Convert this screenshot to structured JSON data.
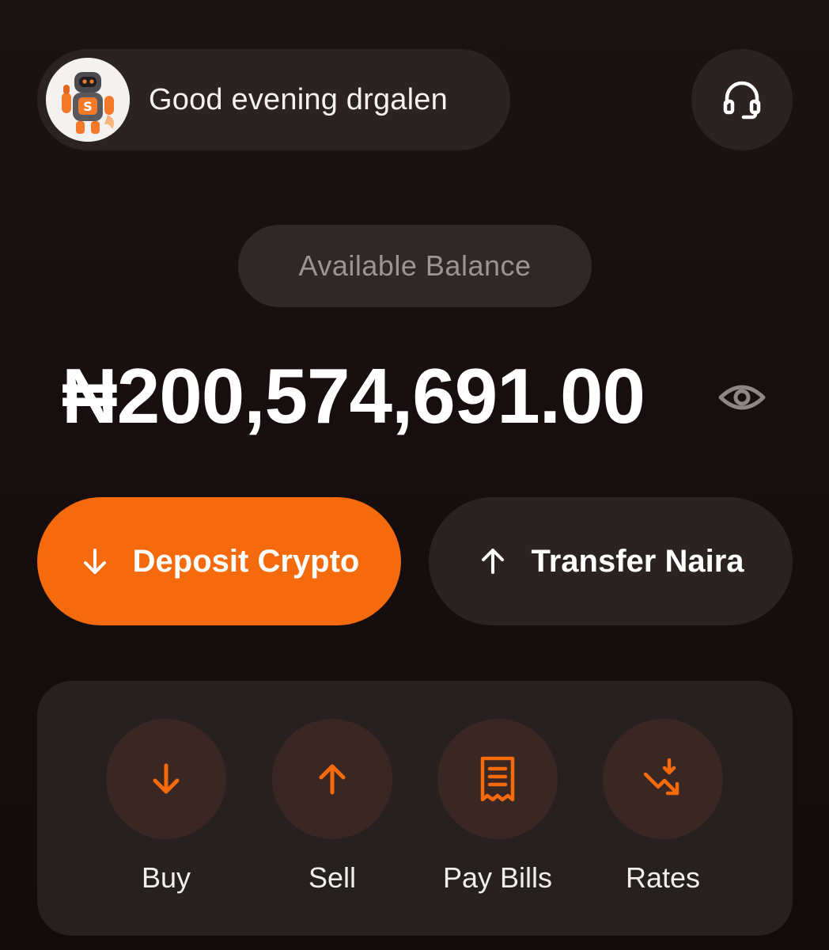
{
  "header": {
    "greeting": "Good evening drgalen",
    "avatar_icon": "robot-mascot-icon",
    "support_icon": "headset-icon"
  },
  "balance": {
    "label": "Available Balance",
    "amount": "₦200,574,691.00",
    "visibility_icon": "eye-icon"
  },
  "actions": {
    "deposit_label": "Deposit Crypto",
    "deposit_icon": "arrow-down-icon",
    "transfer_label": "Transfer Naira",
    "transfer_icon": "arrow-up-icon"
  },
  "quick_actions": [
    {
      "label": "Buy",
      "icon": "arrow-down-icon"
    },
    {
      "label": "Sell",
      "icon": "arrow-up-icon"
    },
    {
      "label": "Pay Bills",
      "icon": "receipt-icon"
    },
    {
      "label": "Rates",
      "icon": "trend-down-icon"
    }
  ],
  "colors": {
    "accent": "#f46a0d",
    "background": "#170f0f",
    "surface": "#2a2322",
    "icon_circle": "#3a2622"
  }
}
